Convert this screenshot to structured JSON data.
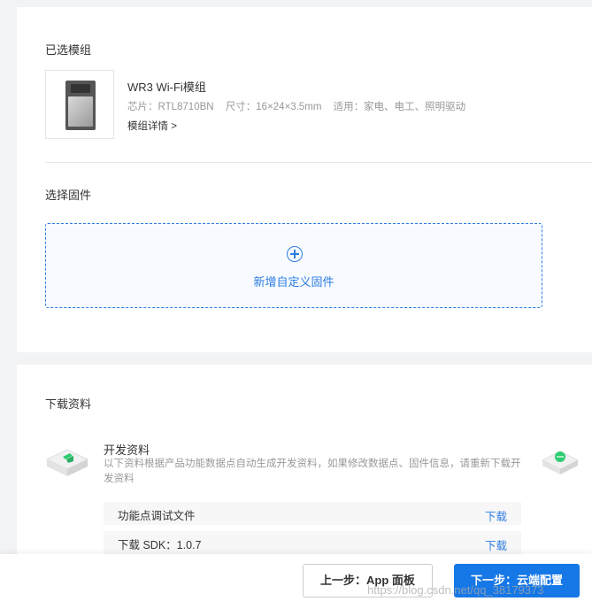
{
  "selected_module": {
    "section_title": "已选模组",
    "name": "WR3 Wi-Fi模组",
    "chip": "芯片：RTL8710BN",
    "size": "尺寸：16×24×3.5mm",
    "usage": "适用：家电、电工、照明驱动",
    "details_link": "模组详情 >"
  },
  "firmware": {
    "section_title": "选择固件",
    "add_label": "新增自定义固件"
  },
  "downloads": {
    "section_title": "下载资料",
    "dev_title": "开发资料",
    "dev_desc": "以下资料根据产品功能数据点自动生成开发资料，如果修改数据点、固件信息，请重新下载开发资料",
    "rows": [
      {
        "label": "功能点调试文件",
        "link": "下载"
      },
      {
        "label": "下载 SDK：1.0.7",
        "link": "下载"
      }
    ]
  },
  "footer": {
    "prev_label": "上一步：App 面板",
    "next_label": "下一步：云端配置"
  },
  "watermark": "https://blog.csdn.net/qq_38179373",
  "colors": {
    "accent": "#1677e6",
    "link": "#2f7de1",
    "brand_icon": "#2ecc71"
  }
}
